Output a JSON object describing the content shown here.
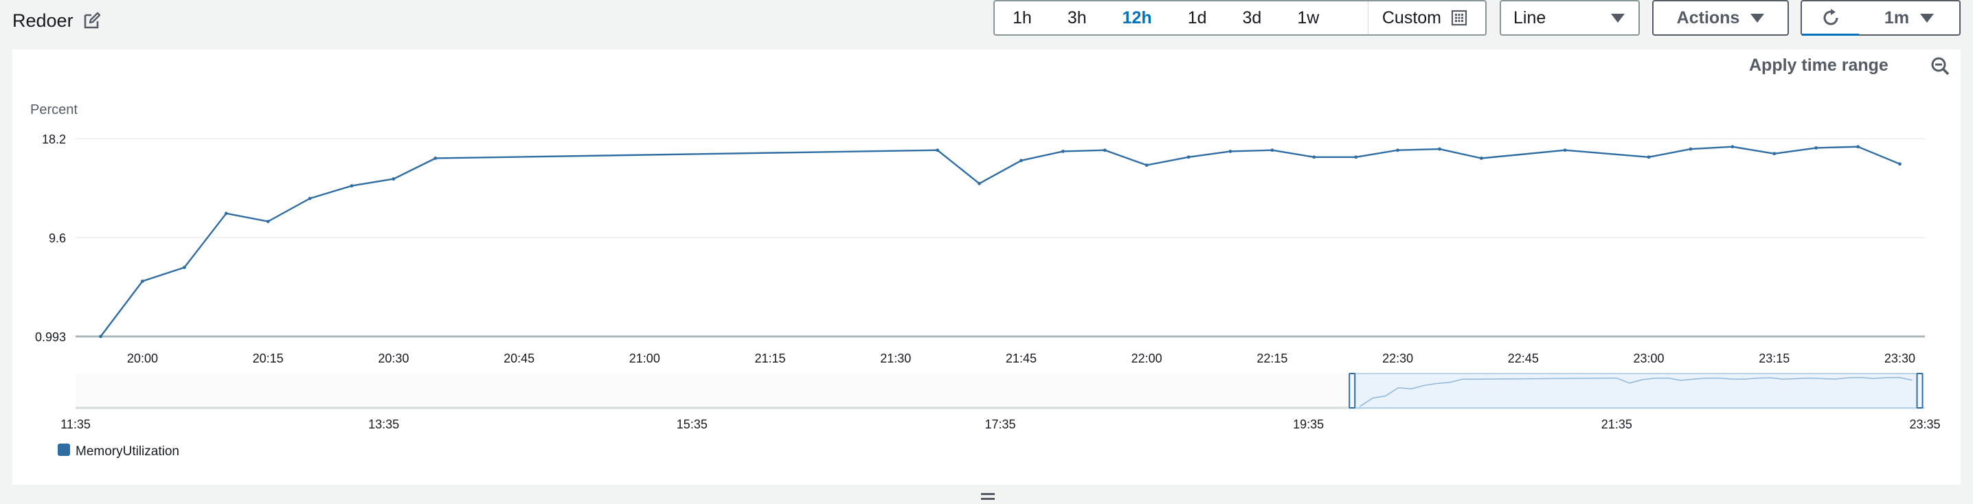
{
  "header": {
    "title": "Redoer"
  },
  "time_ranges": [
    {
      "label": "1h",
      "active": false
    },
    {
      "label": "3h",
      "active": false
    },
    {
      "label": "12h",
      "active": true
    },
    {
      "label": "1d",
      "active": false
    },
    {
      "label": "3d",
      "active": false
    },
    {
      "label": "1w",
      "active": false
    }
  ],
  "custom_label": "Custom",
  "chart_type_select": {
    "value": "Line"
  },
  "actions_label": "Actions",
  "refresh_interval": "1m",
  "apply_time_range": "Apply time range",
  "colors": {
    "series": "#2e6ca4",
    "accent": "#0073bb",
    "grid": "#eaeded"
  },
  "chart_data": {
    "type": "line",
    "ylabel": "Percent",
    "yticks": [
      "18.2",
      "9.6",
      "0.993"
    ],
    "ylim": [
      0.993,
      18.2
    ],
    "xlim": [
      "19:52",
      "23:33"
    ],
    "xticks": [
      "20:00",
      "20:15",
      "20:30",
      "20:45",
      "21:00",
      "21:15",
      "21:30",
      "21:45",
      "22:00",
      "22:15",
      "22:30",
      "22:45",
      "23:00",
      "23:15",
      "23:30"
    ],
    "series": [
      {
        "name": "MemoryUtilization",
        "color": "#2e6ca4",
        "x": [
          "19:55",
          "20:00",
          "20:05",
          "20:10",
          "20:15",
          "20:20",
          "20:25",
          "20:30",
          "20:35",
          "21:35",
          "21:40",
          "21:45",
          "21:50",
          "21:55",
          "22:00",
          "22:05",
          "22:10",
          "22:15",
          "22:20",
          "22:25",
          "22:30",
          "22:35",
          "22:40",
          "22:50",
          "23:00",
          "23:05",
          "23:10",
          "23:15",
          "23:20",
          "23:25",
          "23:30"
        ],
        "values": [
          0.993,
          5.8,
          7.0,
          11.7,
          11.0,
          13.0,
          14.1,
          14.7,
          16.5,
          17.2,
          14.3,
          16.3,
          17.1,
          17.2,
          15.9,
          16.6,
          17.1,
          17.2,
          16.6,
          16.6,
          17.2,
          17.3,
          16.5,
          17.2,
          16.6,
          17.3,
          17.5,
          16.9,
          17.4,
          17.5,
          16.0
        ]
      }
    ],
    "legend": "bottom-left",
    "grid": true
  },
  "overview": {
    "xticks": [
      "11:35",
      "13:35",
      "15:35",
      "17:35",
      "19:35",
      "21:35",
      "23:35"
    ],
    "xlim": [
      "11:35",
      "23:35"
    ],
    "selection": [
      "19:52",
      "23:33"
    ]
  }
}
